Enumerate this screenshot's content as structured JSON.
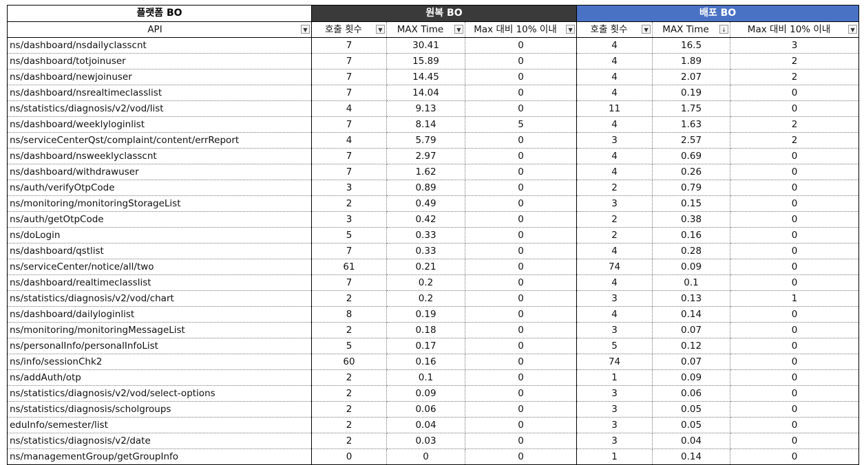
{
  "group_headers": {
    "platform": "플랫폼 BO",
    "original": "원복 BO",
    "deploy": "배포 BO"
  },
  "column_headers": [
    "API",
    "호출 횟수",
    "MAX Time",
    "Max 대비 10% 이내",
    "호출 횟수",
    "MAX Time",
    "Max 대비 10% 이내"
  ],
  "icons": {
    "dropdown": "filter-dropdown-icon",
    "sort_dropdown": "sort-filter-dropdown-icon"
  },
  "colors": {
    "original_header_bg": "#3a3a3a",
    "deploy_header_bg": "#4a72c4",
    "header_text": "#ffffff"
  },
  "rows": [
    [
      "ns/dashboard/nsdailyclasscnt",
      "7",
      "30.41",
      "0",
      "4",
      "16.5",
      "3"
    ],
    [
      "ns/dashboard/totjoinuser",
      "7",
      "15.89",
      "0",
      "4",
      "1.89",
      "2"
    ],
    [
      "ns/dashboard/newjoinuser",
      "7",
      "14.45",
      "0",
      "4",
      "2.07",
      "2"
    ],
    [
      "ns/dashboard/nsrealtimeclasslist",
      "7",
      "14.04",
      "0",
      "4",
      "0.19",
      "0"
    ],
    [
      "ns/statistics/diagnosis/v2/vod/list",
      "4",
      "9.13",
      "0",
      "11",
      "1.75",
      "0"
    ],
    [
      "ns/dashboard/weeklyloginlist",
      "7",
      "8.14",
      "5",
      "4",
      "1.63",
      "2"
    ],
    [
      "ns/serviceCenterQst/complaint/content/errReport",
      "4",
      "5.79",
      "0",
      "3",
      "2.57",
      "2"
    ],
    [
      "ns/dashboard/nsweeklyclasscnt",
      "7",
      "2.97",
      "0",
      "4",
      "0.69",
      "0"
    ],
    [
      "ns/dashboard/withdrawuser",
      "7",
      "1.62",
      "0",
      "4",
      "0.26",
      "0"
    ],
    [
      "ns/auth/verifyOtpCode",
      "3",
      "0.89",
      "0",
      "2",
      "0.79",
      "0"
    ],
    [
      "ns/monitoring/monitoringStorageList",
      "2",
      "0.49",
      "0",
      "3",
      "0.15",
      "0"
    ],
    [
      "ns/auth/getOtpCode",
      "3",
      "0.42",
      "0",
      "2",
      "0.38",
      "0"
    ],
    [
      "ns/doLogin",
      "5",
      "0.33",
      "0",
      "2",
      "0.16",
      "0"
    ],
    [
      "ns/dashboard/qstlist",
      "7",
      "0.33",
      "0",
      "4",
      "0.28",
      "0"
    ],
    [
      "ns/serviceCenter/notice/all/two",
      "61",
      "0.21",
      "0",
      "74",
      "0.09",
      "0"
    ],
    [
      "ns/dashboard/realtimeclasslist",
      "7",
      "0.2",
      "0",
      "4",
      "0.1",
      "0"
    ],
    [
      "ns/statistics/diagnosis/v2/vod/chart",
      "2",
      "0.2",
      "0",
      "3",
      "0.13",
      "1"
    ],
    [
      "ns/dashboard/dailyloginlist",
      "8",
      "0.19",
      "0",
      "4",
      "0.14",
      "0"
    ],
    [
      "ns/monitoring/monitoringMessageList",
      "2",
      "0.18",
      "0",
      "3",
      "0.07",
      "0"
    ],
    [
      "ns/personalInfo/personalInfoList",
      "5",
      "0.17",
      "0",
      "5",
      "0.12",
      "0"
    ],
    [
      "ns/info/sessionChk2",
      "60",
      "0.16",
      "0",
      "74",
      "0.07",
      "0"
    ],
    [
      "ns/addAuth/otp",
      "2",
      "0.1",
      "0",
      "1",
      "0.09",
      "0"
    ],
    [
      "ns/statistics/diagnosis/v2/vod/select-options",
      "2",
      "0.09",
      "0",
      "3",
      "0.06",
      "0"
    ],
    [
      "ns/statistics/diagnosis/scholgroups",
      "2",
      "0.06",
      "0",
      "3",
      "0.05",
      "0"
    ],
    [
      "eduInfo/semester/list",
      "2",
      "0.04",
      "0",
      "3",
      "0.05",
      "0"
    ],
    [
      "ns/statistics/diagnosis/v2/date",
      "2",
      "0.03",
      "0",
      "3",
      "0.04",
      "0"
    ],
    [
      "ns/managementGroup/getGroupInfo",
      "0",
      "0",
      "0",
      "1",
      "0.14",
      "0"
    ]
  ]
}
